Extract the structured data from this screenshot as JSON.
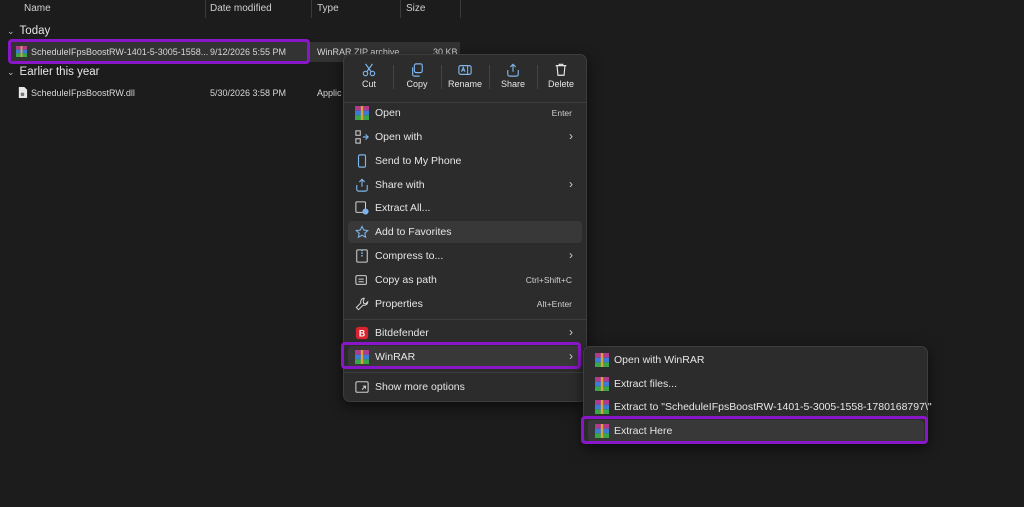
{
  "columns": {
    "name": "Name",
    "date": "Date modified",
    "type": "Type",
    "size": "Size"
  },
  "groups": [
    {
      "label": "Today",
      "files": [
        {
          "name": "ScheduleIFpsBoostRW-1401-5-3005-1558...",
          "date": "9/12/2026 5:55 PM",
          "type": "WinRAR ZIP archive",
          "size": "30 KB"
        }
      ]
    },
    {
      "label": "Earlier this year",
      "files": [
        {
          "name": "ScheduleIFpsBoostRW.dll",
          "date": "5/30/2026 3:58 PM",
          "type": "Applic"
        }
      ]
    }
  ],
  "quick_actions": [
    {
      "label": "Cut",
      "icon": "scissors-icon"
    },
    {
      "label": "Copy",
      "icon": "copy-icon"
    },
    {
      "label": "Rename",
      "icon": "rename-icon"
    },
    {
      "label": "Share",
      "icon": "share-icon"
    },
    {
      "label": "Delete",
      "icon": "trash-icon"
    }
  ],
  "menu": [
    {
      "label": "Open",
      "shortcut": "Enter",
      "icon": "winrar-icon"
    },
    {
      "label": "Open with",
      "icon": "open-with-icon"
    },
    {
      "label": "Send to My Phone",
      "icon": "phone-icon"
    },
    {
      "label": "Share with",
      "icon": "share-with-icon"
    },
    {
      "label": "Extract All...",
      "icon": "extract-all-icon"
    },
    {
      "label": "Add to Favorites",
      "icon": "star-icon"
    },
    {
      "label": "Compress to...",
      "icon": "compress-icon"
    },
    {
      "label": "Copy as path",
      "shortcut": "Ctrl+Shift+C",
      "icon": "copy-path-icon"
    },
    {
      "label": "Properties",
      "shortcut": "Alt+Enter",
      "icon": "wrench-icon"
    },
    {
      "label": "Bitdefender",
      "icon": "bitdefender-icon"
    },
    {
      "label": "WinRAR",
      "icon": "winrar-icon"
    },
    {
      "label": "Show more options",
      "icon": "more-options-icon"
    }
  ],
  "submenu": [
    {
      "label": "Open with WinRAR",
      "icon": "winrar-icon"
    },
    {
      "label": "Extract files...",
      "icon": "winrar-icon"
    },
    {
      "label": "Extract to \"ScheduleIFpsBoostRW-1401-5-3005-1558-1780168797\\\"",
      "icon": "winrar-icon"
    },
    {
      "label": "Extract Here",
      "icon": "winrar-icon"
    }
  ],
  "colors": {
    "background": "#1c1c1c",
    "menu": "#2c2c2c",
    "highlight": "#8a17c7",
    "accent": "#7eb4ea"
  }
}
